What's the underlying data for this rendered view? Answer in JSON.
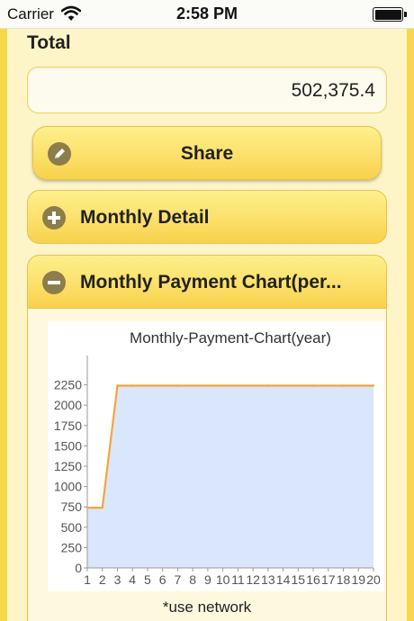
{
  "status_bar": {
    "carrier": "Carrier",
    "time": "2:58 PM",
    "icons": [
      "wifi-icon",
      "battery-icon"
    ]
  },
  "total": {
    "label": "Total",
    "value": "502,375.4"
  },
  "share_button": {
    "label": "Share",
    "icon": "pencil-icon"
  },
  "panels": {
    "monthly_detail": {
      "label": "Monthly Detail",
      "icon": "plus-icon"
    },
    "monthly_payment_chart": {
      "label": "Monthly Payment Chart(per...",
      "icon": "minus-icon"
    }
  },
  "network_note": "*use network",
  "colors": {
    "background": "#fdf5c8",
    "accent_yellow": "#fce06a",
    "line": "#f4a53a",
    "fill": "#dae6fb",
    "icon": "#8c7e4a"
  },
  "chart_data": {
    "type": "area",
    "title": "Monthly-Payment-Chart(year)",
    "xlabel": "",
    "ylabel": "",
    "x": [
      1,
      2,
      3,
      4,
      5,
      6,
      7,
      8,
      9,
      10,
      11,
      12,
      13,
      14,
      15,
      16,
      17,
      18,
      19,
      20
    ],
    "values": [
      740,
      740,
      2240,
      2240,
      2240,
      2240,
      2240,
      2240,
      2240,
      2240,
      2240,
      2240,
      2240,
      2240,
      2240,
      2240,
      2240,
      2240,
      2240,
      2240
    ],
    "yticks": [
      0,
      250,
      500,
      750,
      1000,
      1250,
      1500,
      1750,
      2000,
      2250
    ],
    "ylim": [
      0,
      2500
    ],
    "xlim": [
      1,
      20
    ],
    "grid": false,
    "legend": "none"
  }
}
